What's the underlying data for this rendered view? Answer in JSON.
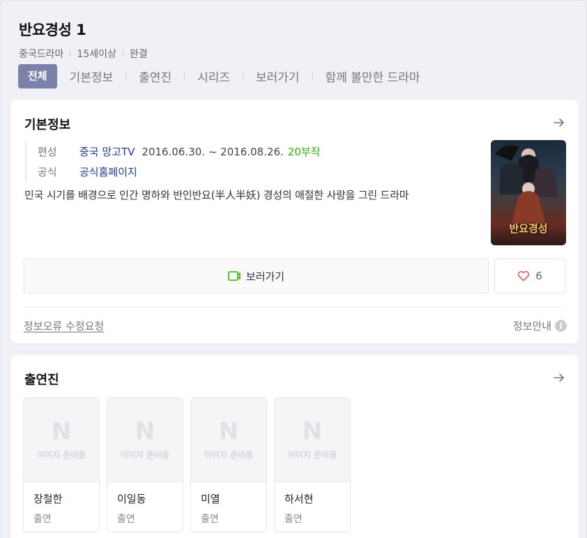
{
  "header": {
    "title": "반요경성 1",
    "meta": [
      "중국드라마",
      "15세이상",
      "완결"
    ]
  },
  "tabs": [
    {
      "label": "전체",
      "active": true
    },
    {
      "label": "기본정보"
    },
    {
      "label": "출연진"
    },
    {
      "label": "시리즈"
    },
    {
      "label": "보러가기"
    },
    {
      "label": "함께 볼만한 드라마"
    }
  ],
  "info": {
    "title": "기본정보",
    "broadcast_key": "편성",
    "broadcast_channel": "중국 망고TV",
    "broadcast_period": "2016.06.30. ~ 2016.08.26.",
    "episodes": "20부작",
    "official_key": "공식",
    "official_link": "공식홈페이지",
    "description": "민국 시기를 배경으로 인간 명하와 반인반요(半人半妖) 경성의 애절한 사랑을 그린 드라마",
    "poster_text": "반요경성",
    "watch_label": "보러가기",
    "like_count": "6",
    "report_label": "정보오류 수정요청",
    "guide_label": "정보안내",
    "guide_icon_glyph": "i"
  },
  "cast": {
    "title": "출연진",
    "placeholder_logo": "N",
    "placeholder_text": "이미지 준비중",
    "members": [
      {
        "name": "장철한",
        "role": "출연"
      },
      {
        "name": "이일동",
        "role": "출연"
      },
      {
        "name": "미열",
        "role": "출연"
      },
      {
        "name": "하서현",
        "role": "출연"
      }
    ]
  },
  "colors": {
    "accent_tab": "#7b81a8",
    "link_blue": "#1f3d8a",
    "episode_green": "#2db400",
    "watch_icon_green": "#2db400",
    "heart_red": "#e8585e"
  },
  "icons": {
    "section_arrow": "arrow-right-icon",
    "watch": "play-box-icon",
    "like": "heart-icon",
    "guide": "info-icon"
  }
}
